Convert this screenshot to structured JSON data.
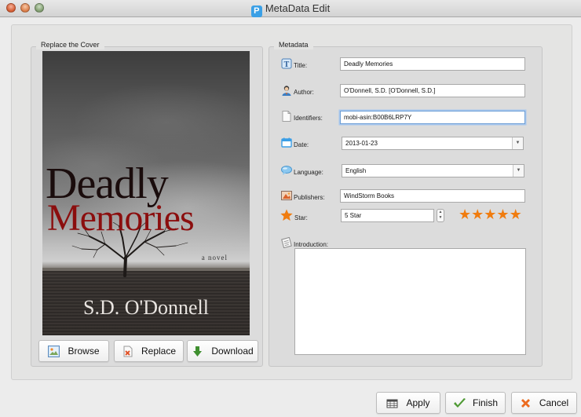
{
  "window": {
    "title": "MetaData Edit",
    "app_icon_glyph": "P"
  },
  "cover_panel": {
    "label": "Replace the Cover",
    "cover_image": {
      "title_line1": "Deadly",
      "title_line2": "Memories",
      "subtitle": "a novel",
      "author": "S.D. O'Donnell"
    },
    "buttons": {
      "browse": "Browse",
      "replace": "Replace",
      "download": "Download"
    }
  },
  "metadata_panel": {
    "label": "Metadata",
    "title": {
      "label": "Title:",
      "value": "Deadly Memories"
    },
    "author": {
      "label": "Author:",
      "value": "O'Donnell, S.D. [O'Donnell, S.D.]"
    },
    "identifiers": {
      "label": "Identifiers:",
      "value": "mobi-asin:B00B6LRP7Y"
    },
    "date": {
      "label": "Date:",
      "value": "2013-01-23"
    },
    "language": {
      "label": "Language:",
      "value": "English"
    },
    "publishers": {
      "label": "Publishers:",
      "value": "WindStorm Books"
    },
    "star": {
      "label": "Star:",
      "value": "5 Star",
      "rating": 5,
      "max_rating": 5
    },
    "introduction": {
      "label": "Introduction:",
      "value": ""
    }
  },
  "footer": {
    "apply": "Apply",
    "finish": "Finish",
    "cancel": "Cancel"
  },
  "colors": {
    "star_orange": "#f07c0f",
    "focus_blue": "#6e9fd6",
    "cover_title_red": "#8b0e0e"
  }
}
